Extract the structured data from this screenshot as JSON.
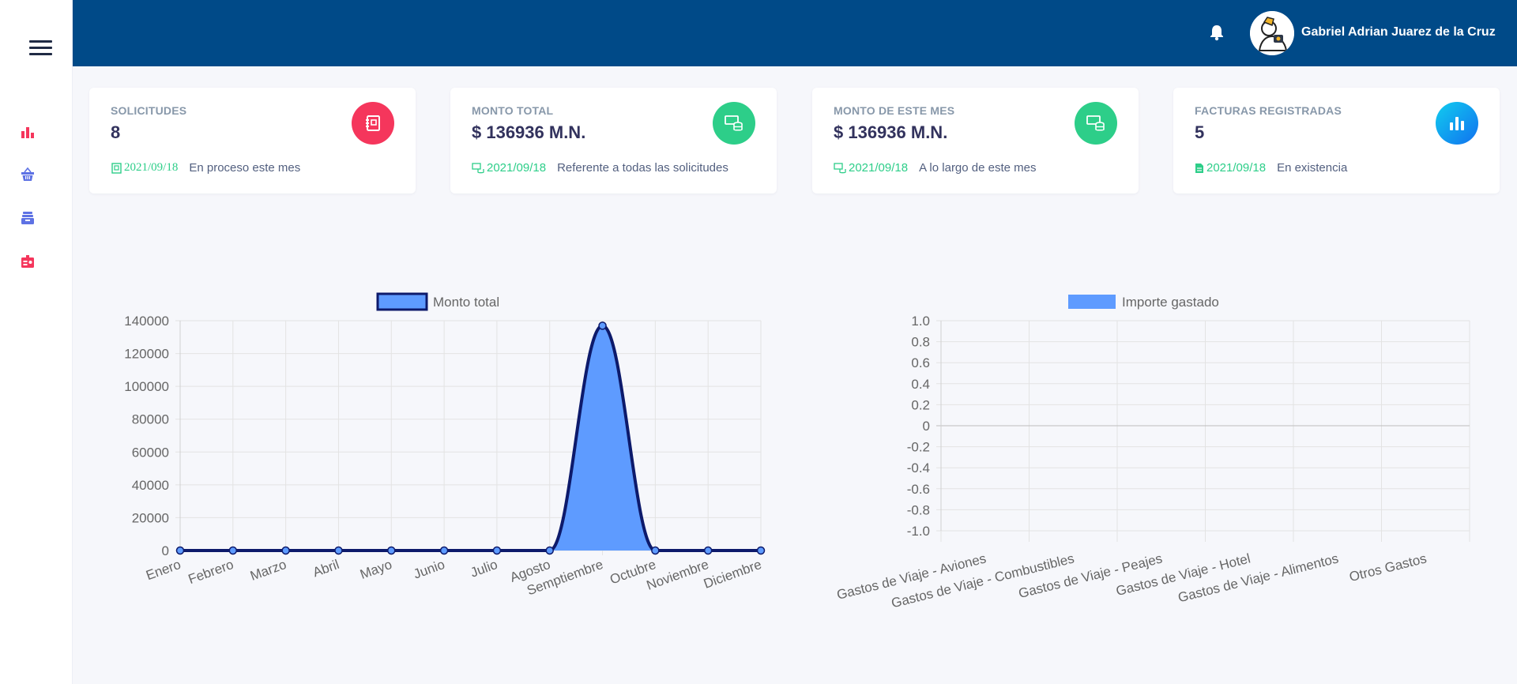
{
  "topbar": {
    "user_name": "Gabriel Adrian Juarez de la Cruz",
    "bg": "#004a88"
  },
  "sidebar": {
    "items": [
      {
        "name": "charts",
        "icon": "bar-chart-icon",
        "color": "#f5365c"
      },
      {
        "name": "shop",
        "icon": "basket-icon",
        "color": "#5e72e4"
      },
      {
        "name": "archive",
        "icon": "archive-icon",
        "color": "#5e72e4"
      },
      {
        "name": "badge",
        "icon": "id-badge-icon",
        "color": "#f5365c"
      }
    ]
  },
  "cards": [
    {
      "label": "SOLICITUDES",
      "value": "8",
      "date": "2021/09/18",
      "text": "En proceso este mes",
      "icon": "notebook-icon",
      "color": "#f5365c"
    },
    {
      "label": "MONTO TOTAL",
      "value": "$ 136936 M.N.",
      "date": "2021/09/18",
      "text": "Referente a todas las solicitudes",
      "icon": "money-icon",
      "color": "#2dce89"
    },
    {
      "label": "MONTO DE ESTE MES",
      "value": "$ 136936 M.N.",
      "date": "2021/09/18",
      "text": "A lo largo de este mes",
      "icon": "money-icon",
      "color": "#2dce89"
    },
    {
      "label": "FACTURAS REGISTRADAS",
      "value": "5",
      "date": "2021/09/18",
      "text": "En existencia",
      "icon": "bar-chart-icon",
      "color": "#11cdef"
    }
  ],
  "chart_data": [
    {
      "type": "area",
      "legend": "Monto total",
      "categories": [
        "Enero",
        "Febrero",
        "Marzo",
        "Abril",
        "Mayo",
        "Junio",
        "Julio",
        "Agosto",
        "Semptiembre",
        "Octubre",
        "Noviembre",
        "Diciembre"
      ],
      "values": [
        0,
        0,
        0,
        0,
        0,
        0,
        0,
        0,
        136936,
        0,
        0,
        0
      ],
      "ylim": [
        0,
        140000
      ],
      "yticks": [
        "140000",
        "120000",
        "100000",
        "80000",
        "60000",
        "40000",
        "20000",
        "0"
      ],
      "fill": "#5e9bff",
      "stroke": "#0d1a6b",
      "grid": true,
      "legend_position": "top"
    },
    {
      "type": "bar",
      "legend": "Importe gastado",
      "categories": [
        "Gastos de Viaje - Aviones",
        "Gastos de Viaje - Combustibles",
        "Gastos de Viaje - Peajes",
        "Gastos de Viaje - Hotel",
        "Gastos de Viaje - Alimentos",
        "Otros Gastos"
      ],
      "values": [
        0,
        0,
        0,
        0,
        0,
        0
      ],
      "ylim": [
        -1.0,
        1.0
      ],
      "yticks": [
        "1.0",
        "0.8",
        "0.6",
        "0.4",
        "0.2",
        "0",
        "-0.2",
        "-0.4",
        "-0.6",
        "-0.8",
        "-1.0"
      ],
      "fill": "#5e9bff",
      "grid": true,
      "legend_position": "top"
    }
  ]
}
